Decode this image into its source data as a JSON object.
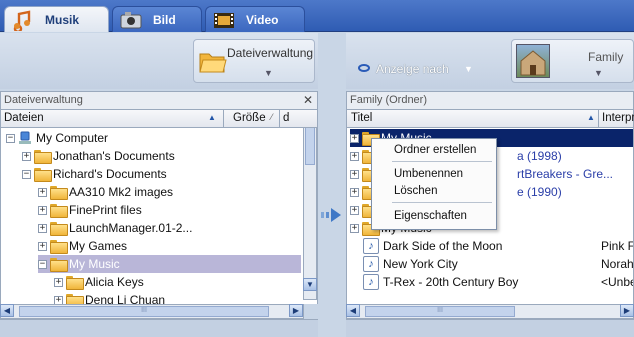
{
  "tabs": [
    {
      "label": "Musik",
      "icon": "music-note-icon",
      "active": true
    },
    {
      "label": "Bild",
      "icon": "camera-icon",
      "active": false
    },
    {
      "label": "Video",
      "icon": "film-icon",
      "active": false
    }
  ],
  "left_toolbar": {
    "button_label": "Dateiverwaltung"
  },
  "right_toolbar": {
    "view_label": "Anzeige nach",
    "view_button_label": "Family"
  },
  "left_pane": {
    "header": "Dateiverwaltung",
    "columns": {
      "files": "Dateien",
      "size": "Größe",
      "d": "d"
    },
    "tree": [
      {
        "label": "My Computer",
        "level": 0,
        "exp": "−"
      },
      {
        "label": "Jonathan's Documents",
        "level": 1,
        "exp": "+"
      },
      {
        "label": "Richard's Documents",
        "level": 1,
        "exp": "−"
      },
      {
        "label": "AA310 Mk2 images",
        "level": 2,
        "exp": "+"
      },
      {
        "label": "FinePrint files",
        "level": 2,
        "exp": "+"
      },
      {
        "label": "LaunchManager.01-2...",
        "level": 2,
        "exp": "+"
      },
      {
        "label": "My Games",
        "level": 2,
        "exp": "+"
      },
      {
        "label": "My Music",
        "level": 2,
        "exp": "−",
        "selected": true
      },
      {
        "label": "Alicia Keys",
        "level": 3,
        "exp": "+"
      },
      {
        "label": "Deng Li Chuan",
        "level": 3,
        "exp": "+"
      }
    ],
    "hscroll_grip": "III"
  },
  "right_pane": {
    "header": "Family (Ordner)",
    "columns": {
      "title": "Titel",
      "artist": "Interpr"
    },
    "rows": [
      {
        "title": "My Music",
        "artist": "",
        "selected": true
      },
      {
        "title": "a (1998)",
        "artist": "",
        "link": true
      },
      {
        "title": "rtBreakers - Gre...",
        "artist": "",
        "link": true
      },
      {
        "title": "e (1990)",
        "artist": "",
        "link": true
      },
      {
        "title": "",
        "artist": ""
      },
      {
        "title": "My Music",
        "artist": ""
      },
      {
        "title": "Dark Side of the Moon",
        "artist": "Pink F"
      },
      {
        "title": "New York City",
        "artist": "Norah"
      },
      {
        "title": "T-Rex - 20th Century Boy",
        "artist": "<Unbe"
      }
    ],
    "hscroll_grip": "III"
  },
  "context_menu": {
    "items": [
      "Ordner erstellen",
      "Umbenennen",
      "Löschen",
      "Eigenschaften"
    ]
  },
  "colors": {
    "accent": "#2f5cb3",
    "selection": "#0a246a",
    "tree_selection": "#b9b6d8"
  }
}
